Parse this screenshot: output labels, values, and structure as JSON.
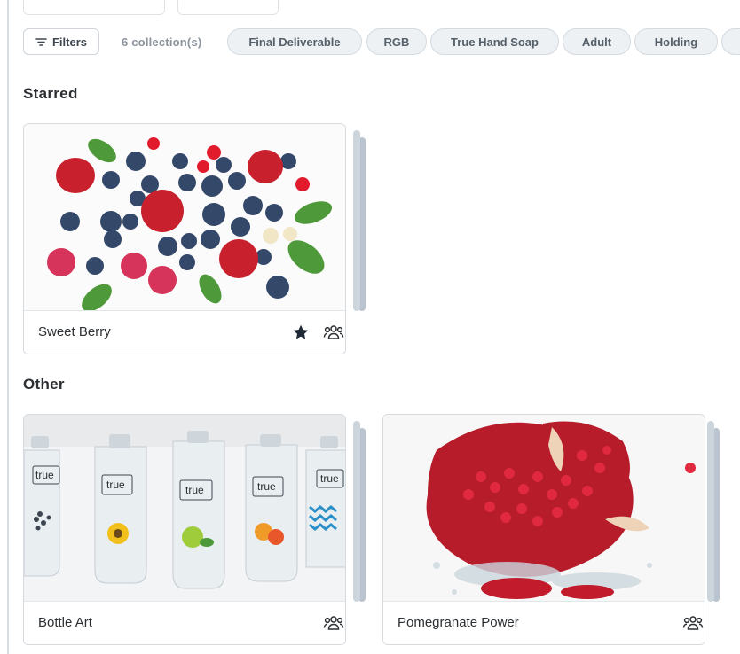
{
  "filter_bar": {
    "filters_label": "Filters",
    "count_label": "6 collection(s)",
    "chips": [
      "Final Deliverable",
      "RGB",
      "True Hand Soap",
      "Adult",
      "Holding"
    ]
  },
  "sections": {
    "starred": {
      "title": "Starred",
      "cards": [
        {
          "title": "Sweet Berry",
          "starred": true,
          "shared": true
        }
      ]
    },
    "other": {
      "title": "Other",
      "cards": [
        {
          "title": "Bottle Art",
          "starred": false,
          "shared": true
        },
        {
          "title": "Pomegranate Power",
          "starred": false,
          "shared": true
        }
      ]
    }
  },
  "bottle_label": "true",
  "colors": {
    "chip_bg": "#eef1f4",
    "stack_gray": "#b9c4ce",
    "text_dark": "#2b2f33",
    "muted": "#8a939c"
  },
  "icons": {
    "filters": "filter-lines-icon",
    "star": "star-icon",
    "shared": "users-group-icon"
  }
}
